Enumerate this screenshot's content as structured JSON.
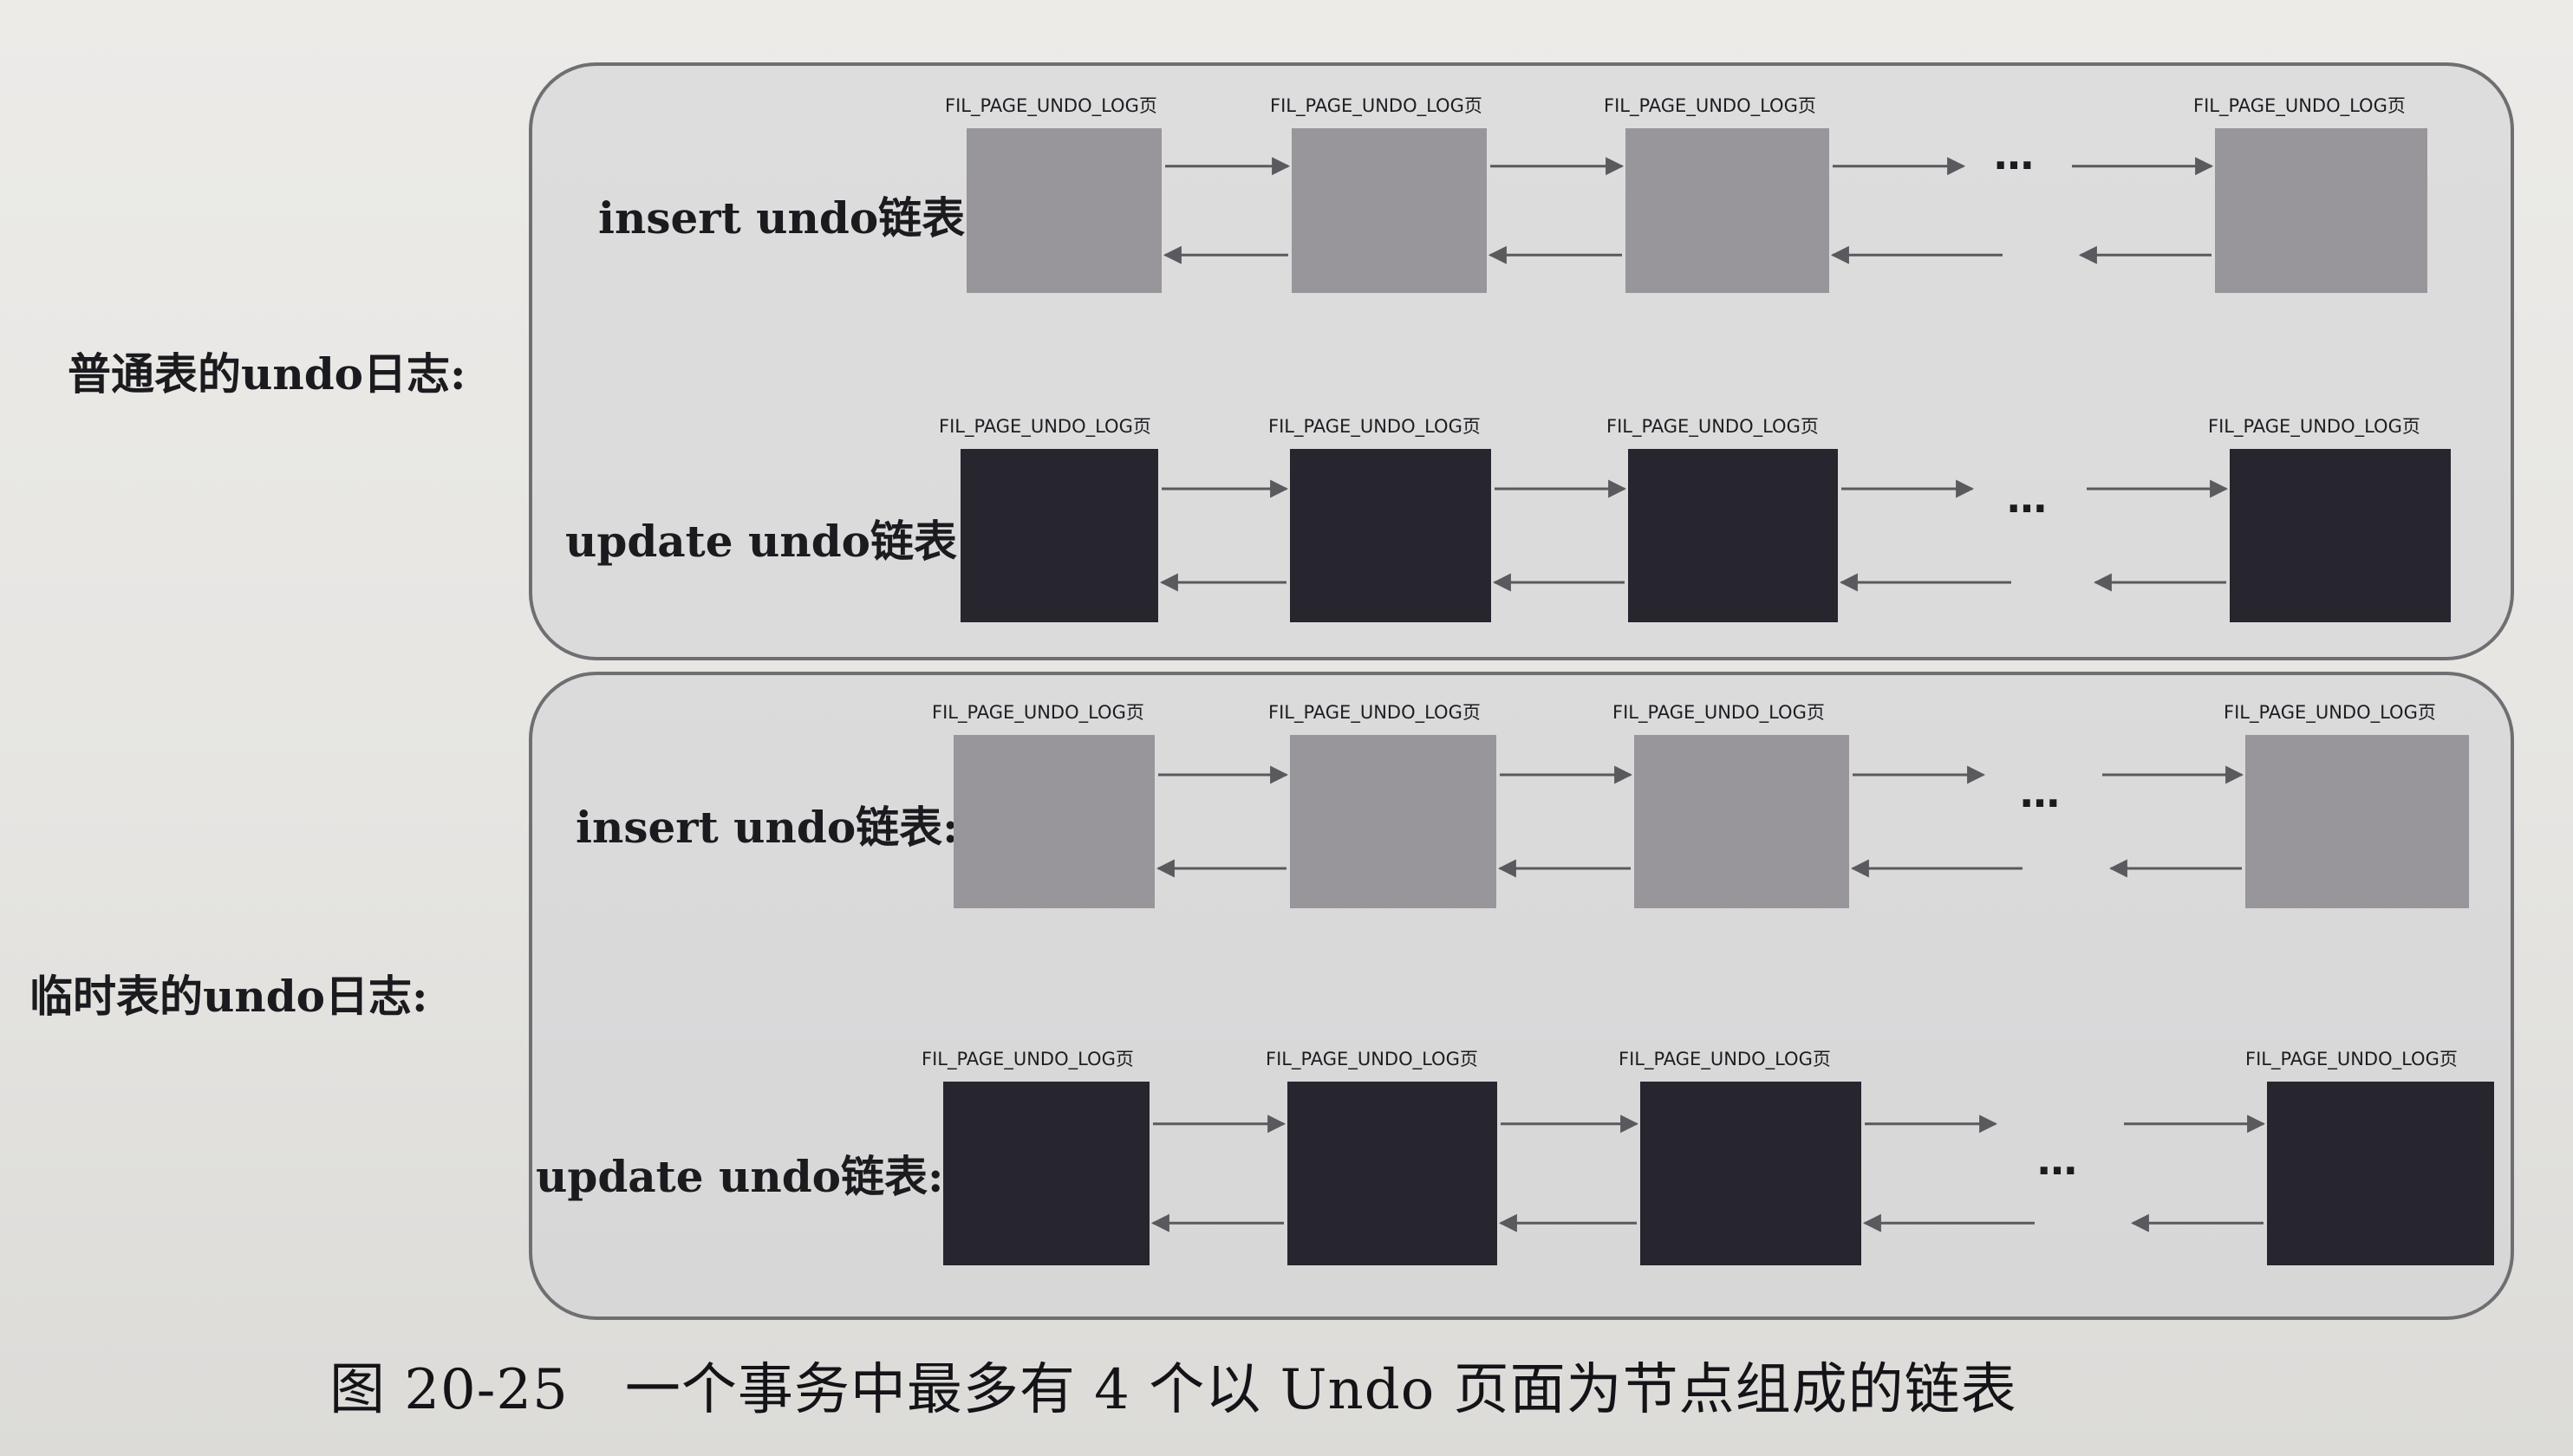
{
  "groups": [
    {
      "id": "normal",
      "label": "普通表的undo日志:",
      "chains": [
        {
          "label": "insert undo链表:",
          "kind": "insert",
          "page_caption": "FIL_PAGE_UNDO_LOG页",
          "ellipsis": "…"
        },
        {
          "label": "update undo链表:",
          "kind": "update",
          "page_caption": "FIL_PAGE_UNDO_LOG页",
          "ellipsis": "…"
        }
      ]
    },
    {
      "id": "temp",
      "label": "临时表的undo日志:",
      "chains": [
        {
          "label": "insert undo链表:",
          "kind": "insert",
          "page_caption": "FIL_PAGE_UNDO_LOG页",
          "ellipsis": "…"
        },
        {
          "label": "update undo链表:",
          "kind": "update",
          "page_caption": "FIL_PAGE_UNDO_LOG页",
          "ellipsis": "…"
        }
      ]
    }
  ],
  "caption": "图 20-25　一个事务中最多有 4 个以 Undo 页面为节点组成的链表",
  "colors": {
    "insert_page": "#98959b",
    "update_page": "#27262e",
    "frame_border": "#6f6e72",
    "arrow": "#5a595d"
  }
}
